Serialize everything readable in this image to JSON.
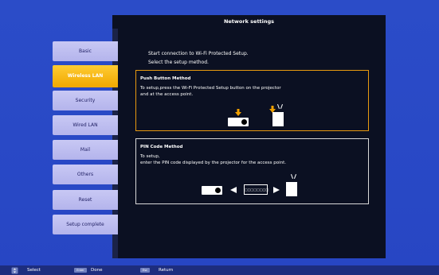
{
  "window": {
    "title": "Network settings"
  },
  "sidebar": {
    "items": [
      {
        "label": "Basic"
      },
      {
        "label": "Wireless LAN"
      },
      {
        "label": "Security"
      },
      {
        "label": "Wired LAN"
      },
      {
        "label": "Mail"
      },
      {
        "label": "Others"
      },
      {
        "label": "Reset"
      },
      {
        "label": "Setup complete"
      }
    ],
    "active_index": 1
  },
  "main": {
    "intro_line1": "Start connection to Wi-Fi Protected Setup.",
    "intro_line2": "Select the setup method.",
    "push_button": {
      "title": "Push Button Method",
      "text_line1": "To setup,press the Wi-Fi Protected Setup button on the projector",
      "text_line2": "and at the access point."
    },
    "pin_code": {
      "title": "PIN Code Method",
      "text_line1": "To setup,",
      "text_line2": "enter the PIN code displayed by the projector for the access point.",
      "pin_placeholder": "□□□□□□□□"
    }
  },
  "footer": {
    "select_label": "Select",
    "done_key": "Enter",
    "done_label": "Done",
    "return_key": "Esc",
    "return_label": "Return"
  },
  "colors": {
    "background": "#2b4cc8",
    "panel": "#0b1022",
    "menu_item": "#c8c8f4",
    "menu_active": "#f0a800",
    "push_button_border": "#e89a10",
    "arrow": "#f0a000"
  },
  "icons": {
    "projector": "projector-icon",
    "access_point": "access-point-icon",
    "arrow_down": "arrow-down-icon",
    "arrow_left": "arrow-left-icon",
    "arrow_right": "arrow-right-icon",
    "dpad": "dpad-icon"
  }
}
